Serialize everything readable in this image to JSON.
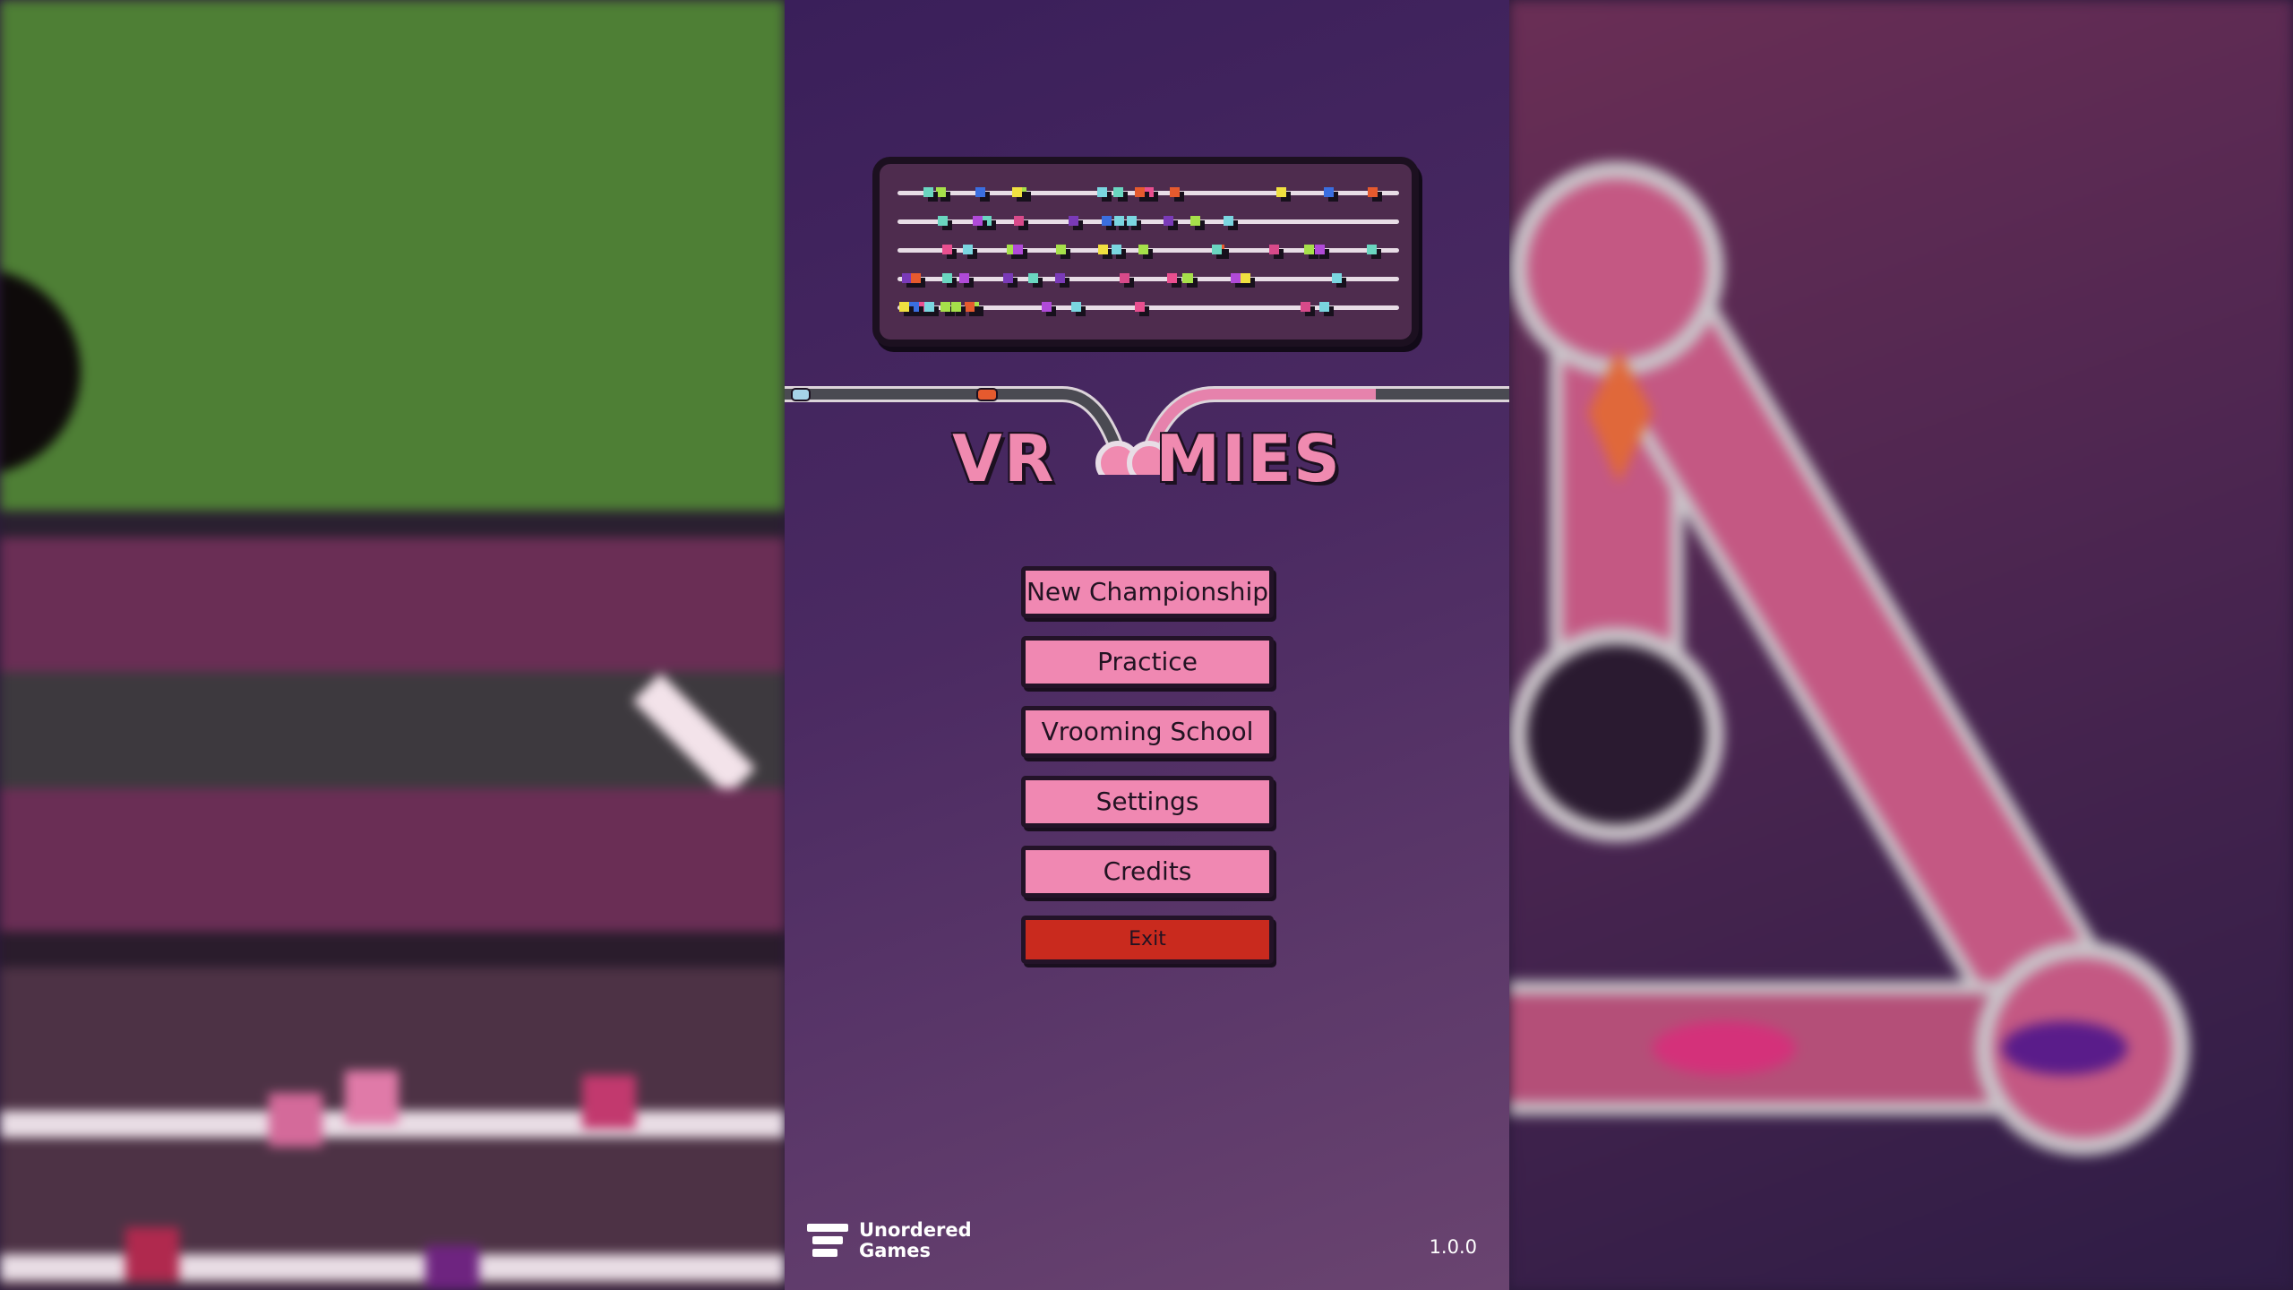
{
  "game": {
    "title": "VROOMIES",
    "title_left": "VR",
    "title_right": "MIES"
  },
  "menu": {
    "items": [
      {
        "label": "New Championship"
      },
      {
        "label": "Practice"
      },
      {
        "label": "Vrooming School"
      },
      {
        "label": "Settings"
      },
      {
        "label": "Credits"
      },
      {
        "label": "Exit"
      }
    ]
  },
  "footer": {
    "brand_line1": "Unordered",
    "brand_line2": "Games",
    "version": "1.0.0"
  },
  "colors": {
    "button_pink": "#f088b2",
    "exit_red": "#c92a1e",
    "logo_pink": "#f08ab0",
    "panel_top": "#3a1f5a",
    "panel_bottom": "#6a4470"
  },
  "icons": {
    "brand_logo": "unordered-games-logo-icon",
    "player_car_left": "blue-car-icon",
    "player_car_right": "orange-car-icon"
  }
}
